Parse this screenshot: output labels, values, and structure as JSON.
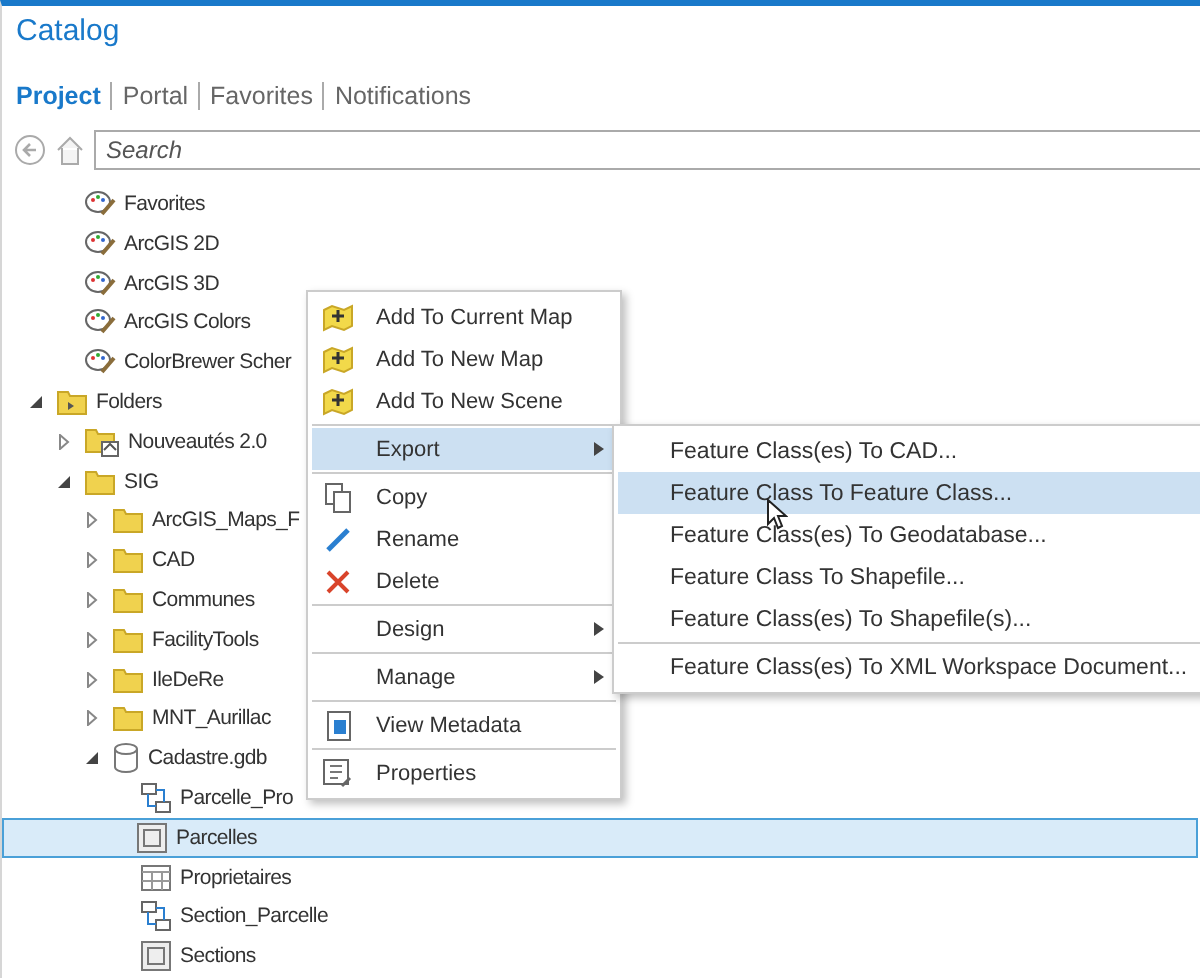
{
  "window": {
    "title": "Catalog"
  },
  "tabs": [
    {
      "label": "Project",
      "selected": true
    },
    {
      "label": "Portal",
      "selected": false
    },
    {
      "label": "Favorites",
      "selected": false
    },
    {
      "label": "Notifications",
      "selected": false
    }
  ],
  "search": {
    "placeholder": "Search"
  },
  "tree": {
    "styles": [
      {
        "label": "Favorites",
        "kind": "style"
      },
      {
        "label": "ArcGIS 2D",
        "kind": "style"
      },
      {
        "label": "ArcGIS 3D",
        "kind": "style"
      },
      {
        "label": "ArcGIS Colors",
        "kind": "style"
      },
      {
        "label": "ColorBrewer Scher",
        "kind": "style"
      }
    ],
    "nodes": [
      {
        "label": "Folders",
        "kind": "folder-link",
        "expanded": true,
        "selected": false,
        "children": [
          {
            "label": "Nouveautés 2.0",
            "kind": "folder-home",
            "expanded": false,
            "selected": false
          },
          {
            "label": "SIG",
            "kind": "folder",
            "expanded": true,
            "selected": false,
            "children": [
              {
                "label": "ArcGIS_Maps_F",
                "kind": "folder",
                "expanded": false,
                "selected": false
              },
              {
                "label": "CAD",
                "kind": "folder",
                "expanded": false,
                "selected": false
              },
              {
                "label": "Communes",
                "kind": "folder",
                "expanded": false,
                "selected": false
              },
              {
                "label": "FacilityTools",
                "kind": "folder",
                "expanded": false,
                "selected": false
              },
              {
                "label": "IleDeRe",
                "kind": "folder",
                "expanded": false,
                "selected": false
              },
              {
                "label": "MNT_Aurillac",
                "kind": "folder",
                "expanded": false,
                "selected": false
              },
              {
                "label": "Cadastre.gdb",
                "kind": "database",
                "expanded": true,
                "selected": false,
                "children": [
                  {
                    "label": "Parcelle_Pro",
                    "kind": "relationship",
                    "selected": false
                  },
                  {
                    "label": "Parcelles",
                    "kind": "feature-class",
                    "selected": true
                  },
                  {
                    "label": "Proprietaires",
                    "kind": "table",
                    "selected": false
                  },
                  {
                    "label": "Section_Parcelle",
                    "kind": "relationship",
                    "selected": false
                  },
                  {
                    "label": "Sections",
                    "kind": "feature-class",
                    "selected": false
                  }
                ]
              }
            ]
          }
        ]
      }
    ]
  },
  "context_menu": [
    {
      "kind": "add",
      "label": "Add To Current Map",
      "selected": false
    },
    {
      "kind": "add",
      "label": "Add To New Map",
      "selected": false
    },
    {
      "kind": "add",
      "label": "Add To New Scene",
      "selected": false
    },
    {
      "kind": "separator"
    },
    {
      "kind": "submenu",
      "label": "Export",
      "selected": true
    },
    {
      "kind": "separator"
    },
    {
      "kind": "copy",
      "label": "Copy",
      "selected": false
    },
    {
      "kind": "rename",
      "label": "Rename",
      "selected": false
    },
    {
      "kind": "delete",
      "label": "Delete",
      "selected": false
    },
    {
      "kind": "separator"
    },
    {
      "kind": "submenu",
      "label": "Design",
      "selected": false
    },
    {
      "kind": "separator"
    },
    {
      "kind": "submenu",
      "label": "Manage",
      "selected": false
    },
    {
      "kind": "separator"
    },
    {
      "kind": "metadata",
      "label": "View Metadata",
      "selected": false
    },
    {
      "kind": "separator"
    },
    {
      "kind": "properties",
      "label": "Properties",
      "selected": false
    }
  ],
  "export_submenu": [
    {
      "kind": "item",
      "label": "Feature Class(es) To CAD...",
      "selected": false
    },
    {
      "kind": "item",
      "label": "Feature Class To Feature Class...",
      "selected": true
    },
    {
      "kind": "item",
      "label": "Feature Class(es) To Geodatabase...",
      "selected": false
    },
    {
      "kind": "item",
      "label": "Feature Class To Shapefile...",
      "selected": false
    },
    {
      "kind": "item",
      "label": "Feature Class(es) To Shapefile(s)...",
      "selected": false
    },
    {
      "kind": "separator"
    },
    {
      "kind": "item",
      "label": "Feature Class(es) To XML Workspace Document...",
      "selected": false
    }
  ]
}
